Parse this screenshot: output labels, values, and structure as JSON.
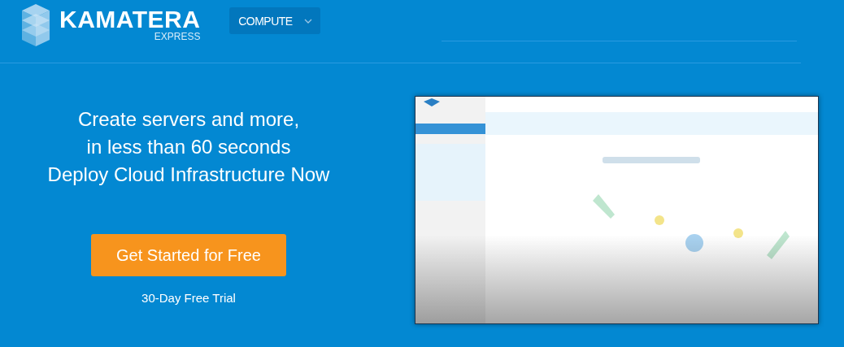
{
  "header": {
    "logo": {
      "name": "KAMATERA",
      "tagline": "EXPRESS"
    },
    "nav_dropdown": {
      "label": "COMPUTE",
      "expanded": false
    }
  },
  "hero": {
    "headline": [
      "Create servers and more,",
      "in less than 60 seconds",
      "Deploy Cloud Infrastructure Now"
    ],
    "cta": "Get Started for Free",
    "note": "30-Day Free Trial"
  }
}
